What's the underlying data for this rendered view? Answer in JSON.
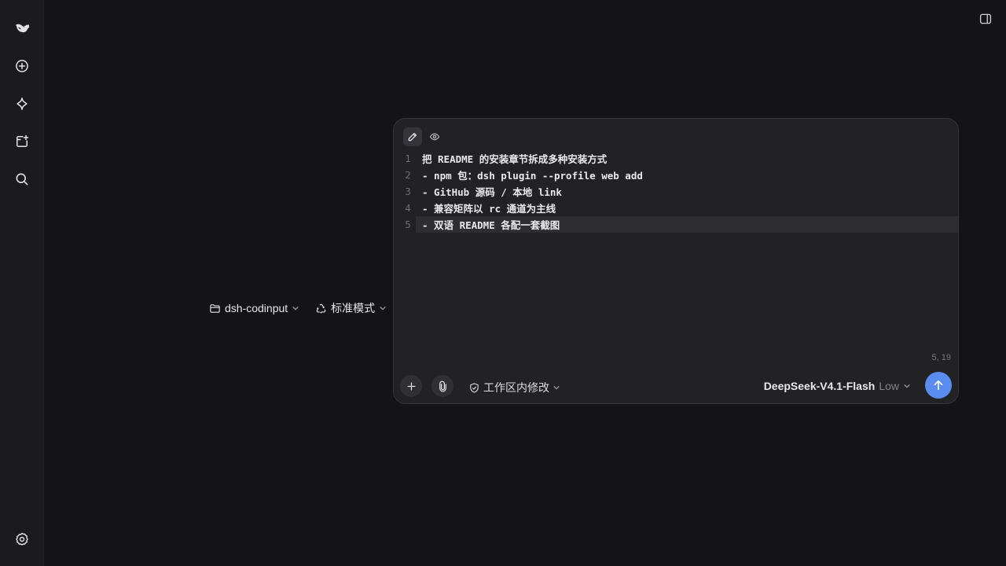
{
  "sidebar": {
    "items": [
      {
        "name": "logo",
        "icon": "whale-logo-icon"
      },
      {
        "name": "new-chat",
        "icon": "plus-circle-icon"
      },
      {
        "name": "explore",
        "icon": "sparkle-icon"
      },
      {
        "name": "new-window",
        "icon": "window-plus-icon"
      },
      {
        "name": "search",
        "icon": "search-icon"
      },
      {
        "name": "settings",
        "icon": "gear-icon"
      }
    ]
  },
  "context": {
    "folder": "dsh-codinput",
    "mode": "标准模式"
  },
  "composer": {
    "lines": [
      {
        "num": "1",
        "text": "把 README 的安装章节拆成多种安装方式"
      },
      {
        "num": "2",
        "text": "- npm 包：dsh plugin --profile web add"
      },
      {
        "num": "3",
        "text": "- GitHub 源码 / 本地 link"
      },
      {
        "num": "4",
        "text": "- 兼容矩阵以 rc 通道为主线"
      },
      {
        "num": "5",
        "text": "- 双语 README 各配一套截图"
      }
    ],
    "cursor_position": "5, 19",
    "permission": "工作区内修改",
    "model": "DeepSeek-V4.1-Flash",
    "effort": "Low"
  },
  "colors": {
    "accent": "#5a8cf0",
    "background": "#141416",
    "sidebar": "#1b1b1e",
    "composer": "#222225"
  }
}
